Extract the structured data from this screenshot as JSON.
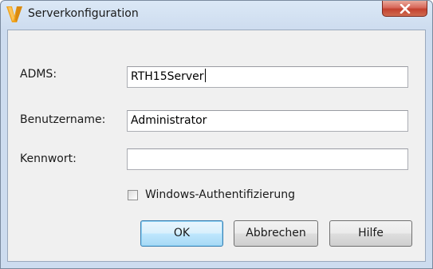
{
  "window": {
    "title": "Serverkonfiguration",
    "icon": "autodesk-vault-v-icon",
    "close_icon": "close-x-icon"
  },
  "form": {
    "adms_label": "ADMS:",
    "adms_value": "RTH15Server",
    "username_label": "Benutzername:",
    "username_value": "Administrator",
    "password_label": "Kennwort:",
    "password_value": "",
    "windows_auth_label": "Windows-Authentifizierung",
    "windows_auth_checked": false
  },
  "buttons": {
    "ok_label": "OK",
    "cancel_label": "Abbrechen",
    "help_label": "Hilfe"
  },
  "colors": {
    "accent": "#3c7fb1",
    "close_button": "#c3412f",
    "icon_gold": "#f0a31c"
  }
}
